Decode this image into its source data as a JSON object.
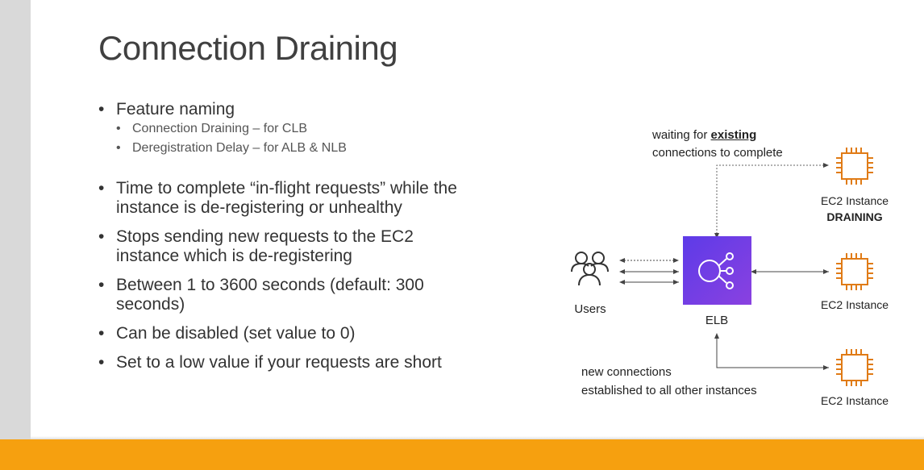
{
  "title": "Connection Draining",
  "bullets": {
    "feature_naming": "Feature naming",
    "sub1": "Connection Draining – for CLB",
    "sub2": "Deregistration Delay – for ALB & NLB",
    "b2_line1": "Time to complete “in-flight requests” while the",
    "b2_line2": "instance is de-registering or unhealthy",
    "b3_line1": "Stops sending new requests to the EC2",
    "b3_line2": "instance which is de-registering",
    "b4_line1": "Between 1 to 3600 seconds (default: 300",
    "b4_line2": "seconds)",
    "b5": "Can be disabled (set value to 0)",
    "b6": "Set to a low value if your requests are short"
  },
  "diagram": {
    "waiting_prefix": "waiting for ",
    "waiting_existing": "existing",
    "waiting_line2": "connections to complete",
    "ec2_draining_label": "EC2 Instance",
    "draining_status": "DRAINING",
    "users_label": "Users",
    "elb_label": "ELB",
    "ec2_middle_label": "EC2 Instance",
    "new_conn_line1": "new connections",
    "new_conn_line2": "established to all other instances",
    "ec2_bottom_label": "EC2 Instance"
  },
  "colors": {
    "ec2_orange": "#e07b16",
    "elb_purple": "#7c3ce6",
    "accent_orange": "#f6a00f"
  }
}
